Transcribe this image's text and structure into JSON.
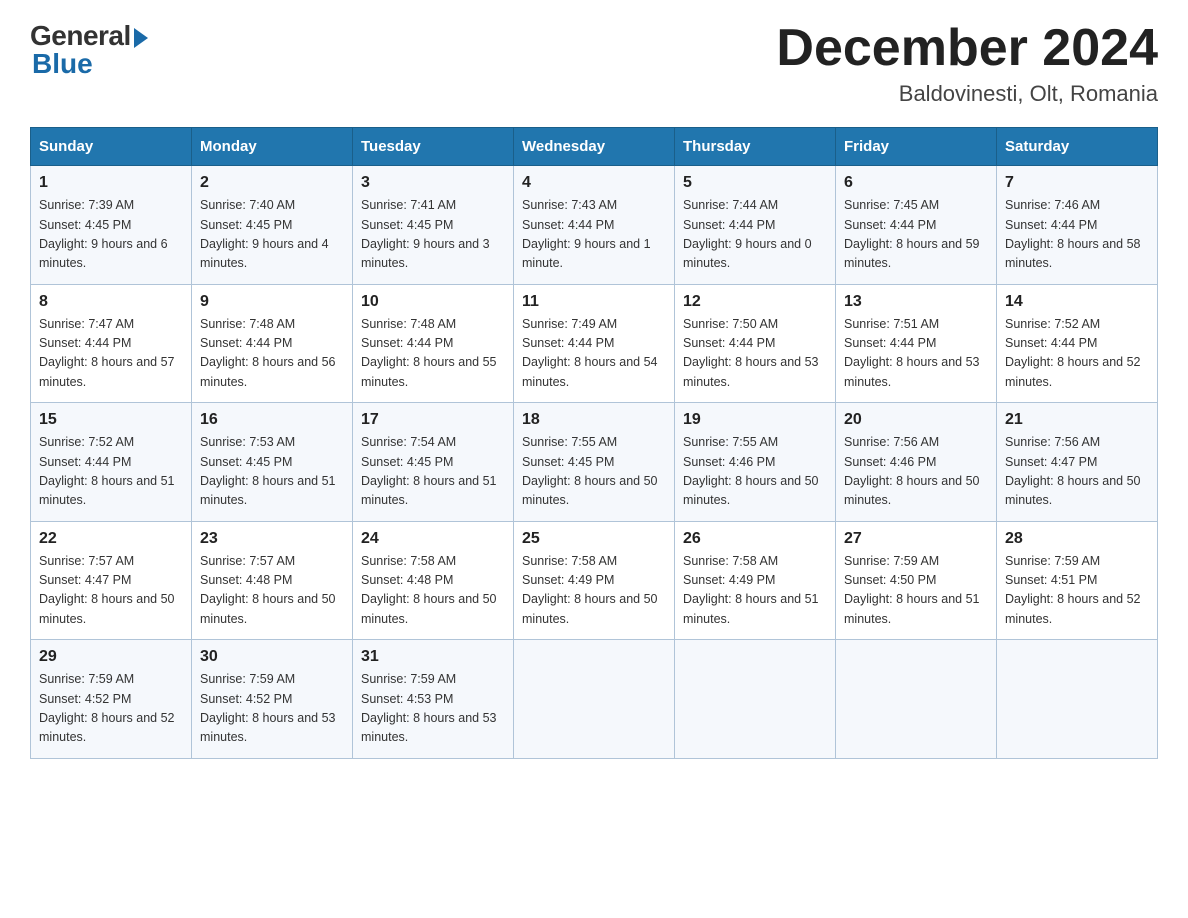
{
  "logo": {
    "general": "General",
    "blue": "Blue"
  },
  "title": "December 2024",
  "location": "Baldovinesti, Olt, Romania",
  "weekdays": [
    "Sunday",
    "Monday",
    "Tuesday",
    "Wednesday",
    "Thursday",
    "Friday",
    "Saturday"
  ],
  "weeks": [
    [
      {
        "day": "1",
        "sunrise": "7:39 AM",
        "sunset": "4:45 PM",
        "daylight": "9 hours and 6 minutes."
      },
      {
        "day": "2",
        "sunrise": "7:40 AM",
        "sunset": "4:45 PM",
        "daylight": "9 hours and 4 minutes."
      },
      {
        "day": "3",
        "sunrise": "7:41 AM",
        "sunset": "4:45 PM",
        "daylight": "9 hours and 3 minutes."
      },
      {
        "day": "4",
        "sunrise": "7:43 AM",
        "sunset": "4:44 PM",
        "daylight": "9 hours and 1 minute."
      },
      {
        "day": "5",
        "sunrise": "7:44 AM",
        "sunset": "4:44 PM",
        "daylight": "9 hours and 0 minutes."
      },
      {
        "day": "6",
        "sunrise": "7:45 AM",
        "sunset": "4:44 PM",
        "daylight": "8 hours and 59 minutes."
      },
      {
        "day": "7",
        "sunrise": "7:46 AM",
        "sunset": "4:44 PM",
        "daylight": "8 hours and 58 minutes."
      }
    ],
    [
      {
        "day": "8",
        "sunrise": "7:47 AM",
        "sunset": "4:44 PM",
        "daylight": "8 hours and 57 minutes."
      },
      {
        "day": "9",
        "sunrise": "7:48 AM",
        "sunset": "4:44 PM",
        "daylight": "8 hours and 56 minutes."
      },
      {
        "day": "10",
        "sunrise": "7:48 AM",
        "sunset": "4:44 PM",
        "daylight": "8 hours and 55 minutes."
      },
      {
        "day": "11",
        "sunrise": "7:49 AM",
        "sunset": "4:44 PM",
        "daylight": "8 hours and 54 minutes."
      },
      {
        "day": "12",
        "sunrise": "7:50 AM",
        "sunset": "4:44 PM",
        "daylight": "8 hours and 53 minutes."
      },
      {
        "day": "13",
        "sunrise": "7:51 AM",
        "sunset": "4:44 PM",
        "daylight": "8 hours and 53 minutes."
      },
      {
        "day": "14",
        "sunrise": "7:52 AM",
        "sunset": "4:44 PM",
        "daylight": "8 hours and 52 minutes."
      }
    ],
    [
      {
        "day": "15",
        "sunrise": "7:52 AM",
        "sunset": "4:44 PM",
        "daylight": "8 hours and 51 minutes."
      },
      {
        "day": "16",
        "sunrise": "7:53 AM",
        "sunset": "4:45 PM",
        "daylight": "8 hours and 51 minutes."
      },
      {
        "day": "17",
        "sunrise": "7:54 AM",
        "sunset": "4:45 PM",
        "daylight": "8 hours and 51 minutes."
      },
      {
        "day": "18",
        "sunrise": "7:55 AM",
        "sunset": "4:45 PM",
        "daylight": "8 hours and 50 minutes."
      },
      {
        "day": "19",
        "sunrise": "7:55 AM",
        "sunset": "4:46 PM",
        "daylight": "8 hours and 50 minutes."
      },
      {
        "day": "20",
        "sunrise": "7:56 AM",
        "sunset": "4:46 PM",
        "daylight": "8 hours and 50 minutes."
      },
      {
        "day": "21",
        "sunrise": "7:56 AM",
        "sunset": "4:47 PM",
        "daylight": "8 hours and 50 minutes."
      }
    ],
    [
      {
        "day": "22",
        "sunrise": "7:57 AM",
        "sunset": "4:47 PM",
        "daylight": "8 hours and 50 minutes."
      },
      {
        "day": "23",
        "sunrise": "7:57 AM",
        "sunset": "4:48 PM",
        "daylight": "8 hours and 50 minutes."
      },
      {
        "day": "24",
        "sunrise": "7:58 AM",
        "sunset": "4:48 PM",
        "daylight": "8 hours and 50 minutes."
      },
      {
        "day": "25",
        "sunrise": "7:58 AM",
        "sunset": "4:49 PM",
        "daylight": "8 hours and 50 minutes."
      },
      {
        "day": "26",
        "sunrise": "7:58 AM",
        "sunset": "4:49 PM",
        "daylight": "8 hours and 51 minutes."
      },
      {
        "day": "27",
        "sunrise": "7:59 AM",
        "sunset": "4:50 PM",
        "daylight": "8 hours and 51 minutes."
      },
      {
        "day": "28",
        "sunrise": "7:59 AM",
        "sunset": "4:51 PM",
        "daylight": "8 hours and 52 minutes."
      }
    ],
    [
      {
        "day": "29",
        "sunrise": "7:59 AM",
        "sunset": "4:52 PM",
        "daylight": "8 hours and 52 minutes."
      },
      {
        "day": "30",
        "sunrise": "7:59 AM",
        "sunset": "4:52 PM",
        "daylight": "8 hours and 53 minutes."
      },
      {
        "day": "31",
        "sunrise": "7:59 AM",
        "sunset": "4:53 PM",
        "daylight": "8 hours and 53 minutes."
      },
      null,
      null,
      null,
      null
    ]
  ],
  "labels": {
    "sunrise": "Sunrise:",
    "sunset": "Sunset:",
    "daylight": "Daylight:"
  }
}
